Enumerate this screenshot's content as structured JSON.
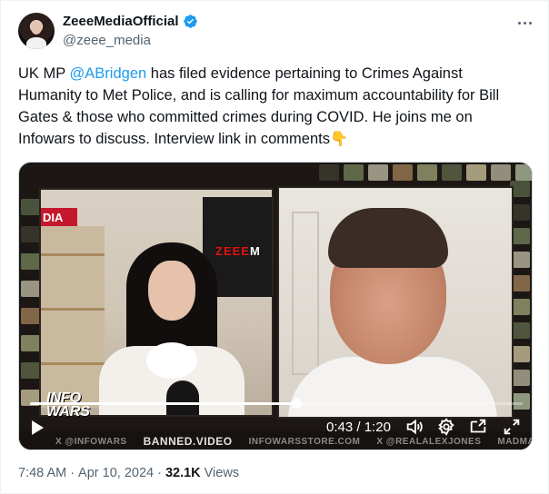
{
  "post": {
    "display_name": "ZeeeMediaOfficial",
    "handle": "@zeee_media",
    "text_before_mention": "UK MP ",
    "mention": "@ABridgen",
    "text_after_mention": " has filed evidence pertaining to Crimes Against Humanity to Met Police, and is calling for maximum accountability for Bill Gates & those who committed crimes during COVID. He joins me on Infowars to discuss. Interview link in comments",
    "emoji": "👇",
    "time": "7:48 AM",
    "separator": "·",
    "date": "Apr 10, 2024",
    "views_count": "32.1K",
    "views_label": "Views"
  },
  "video": {
    "current_time": "0:43",
    "duration": "1:20",
    "time_separator": " / ",
    "progress_fraction": 0.54,
    "overlay": {
      "sign_left": "DIA",
      "screen_red": "ZEEE",
      "screen_white": "M",
      "logo_line1": "INFO",
      "logo_line2": "WARS",
      "strip": [
        "X @INFOWARS",
        "BANNED.VIDEO",
        "INFOWARSSTORE.COM",
        "X @REALALEXJONES",
        "MADMAXWORLD.TV"
      ]
    }
  },
  "colors": {
    "link": "#1d9bf0",
    "verified": "#1d9bf0",
    "secondary_text": "#536471",
    "primary_text": "#0f1419"
  },
  "icons": [
    "verified-badge-icon",
    "more-options-icon",
    "play-icon",
    "volume-icon",
    "settings-icon",
    "pip-icon",
    "fullscreen-icon"
  ]
}
